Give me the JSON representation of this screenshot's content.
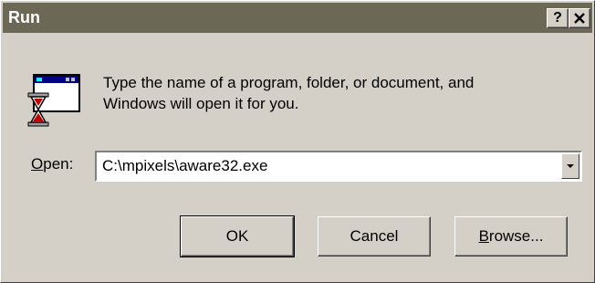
{
  "window": {
    "title": "Run",
    "help_label": "?",
    "close_label": "✕"
  },
  "message": {
    "line1": "Type the name of a program, folder, or document, and",
    "line2": "Windows will open it for you."
  },
  "open_field": {
    "label_accel": "O",
    "label_rest": "pen:",
    "value": "C:\\mpixels\\aware32.exe"
  },
  "buttons": {
    "ok": "OK",
    "cancel": "Cancel",
    "browse_accel": "B",
    "browse_rest": "rowse..."
  },
  "icons": {
    "run": "run-program-icon",
    "dropdown": "chevron-down-icon"
  },
  "colors": {
    "titlebar": "#6b6855",
    "face": "#d4d0c8"
  }
}
